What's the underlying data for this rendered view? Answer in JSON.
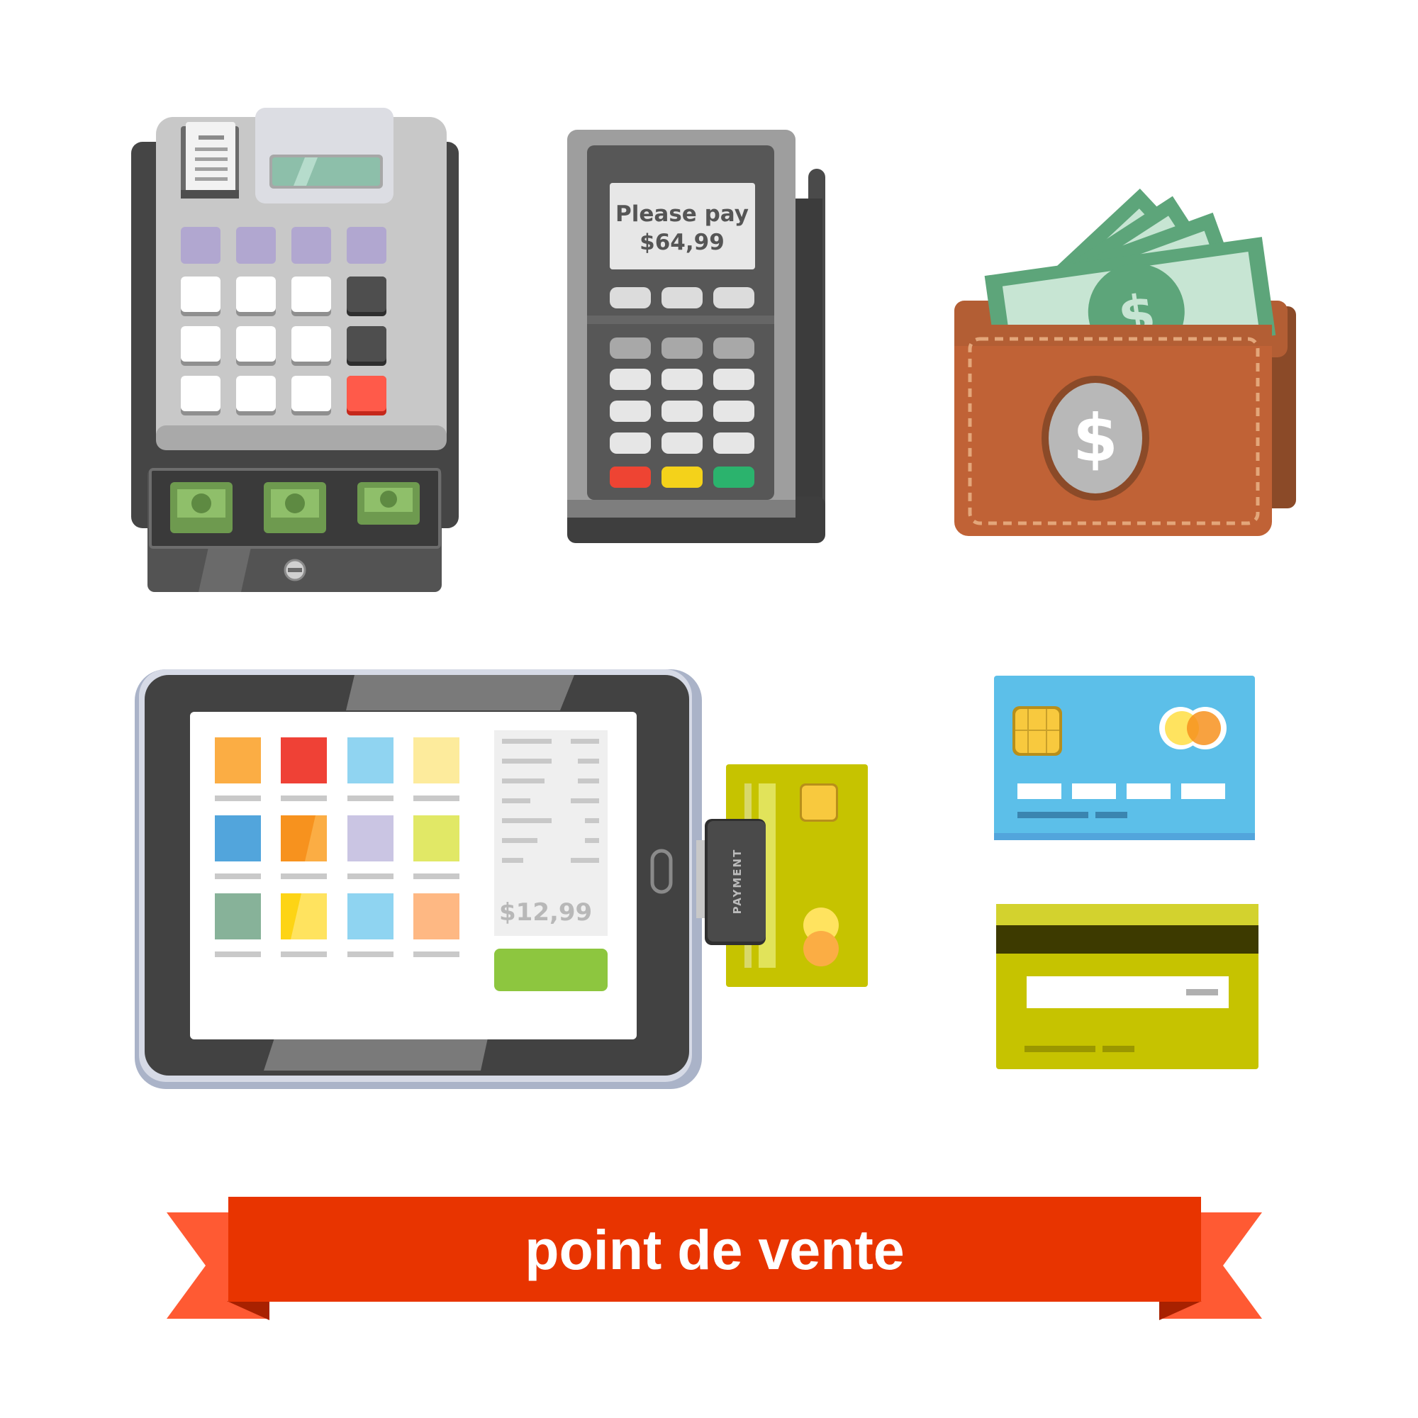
{
  "pos_terminal": {
    "screen_line1": "Please pay",
    "screen_line2": "$64,99"
  },
  "wallet": {
    "emblem": "$"
  },
  "tablet": {
    "receipt_total": "$12,99",
    "card_reader_label": "PAYMENT"
  },
  "banner": {
    "text": "point de vente"
  },
  "colors": {
    "banner_red": "#e83400",
    "banner_tail": "#ff5a33",
    "wallet_brown": "#b35e34",
    "card_blue": "#5cbfe9",
    "card_green": "#c6c300",
    "bill_green": "#5da57a",
    "tablet_dark": "#424242",
    "pay_button_green": "#8dc63f"
  },
  "icons": [
    "cash-register-icon",
    "payment-terminal-icon",
    "wallet-with-banknotes-icon",
    "tablet-pos-icon",
    "credit-card-front-icon",
    "credit-card-back-icon"
  ]
}
